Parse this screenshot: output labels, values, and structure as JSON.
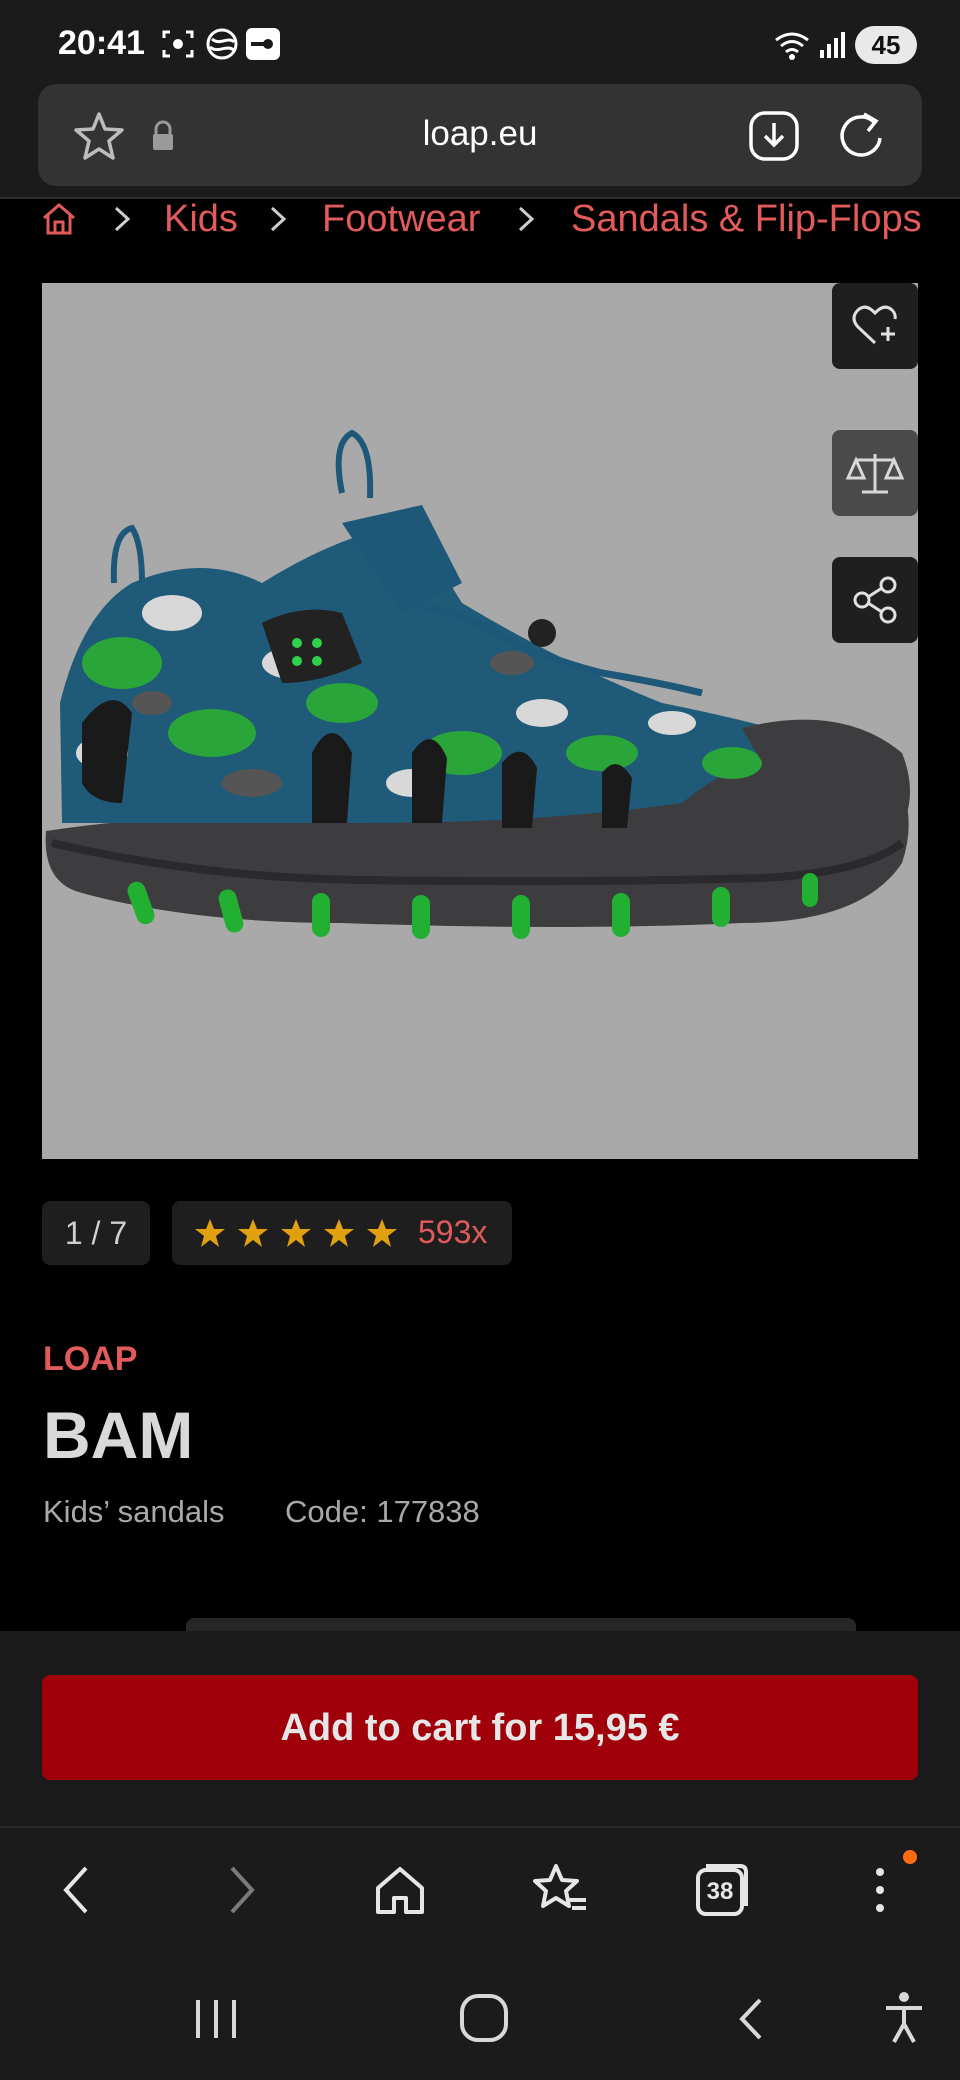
{
  "status_bar": {
    "time": "20:41",
    "battery": "45"
  },
  "browser": {
    "url": "loap.eu",
    "tabs_count": "38"
  },
  "breadcrumb": {
    "items": [
      "Kids",
      "Footwear",
      "Sandals & Flip-Flops"
    ]
  },
  "gallery": {
    "pager": "1 / 7"
  },
  "rating": {
    "stars": 5,
    "count": "593x"
  },
  "product": {
    "brand": "LOAP",
    "name": "BAM",
    "category": "Kids’ sandals",
    "code": "Code: 177838"
  },
  "cart": {
    "button_label": "Add to cart for 15,95 €"
  },
  "colors": {
    "accent": "#e35a5a",
    "cart_button": "#a0000a",
    "star": "#e0a010",
    "notification": "#ff6a13"
  }
}
